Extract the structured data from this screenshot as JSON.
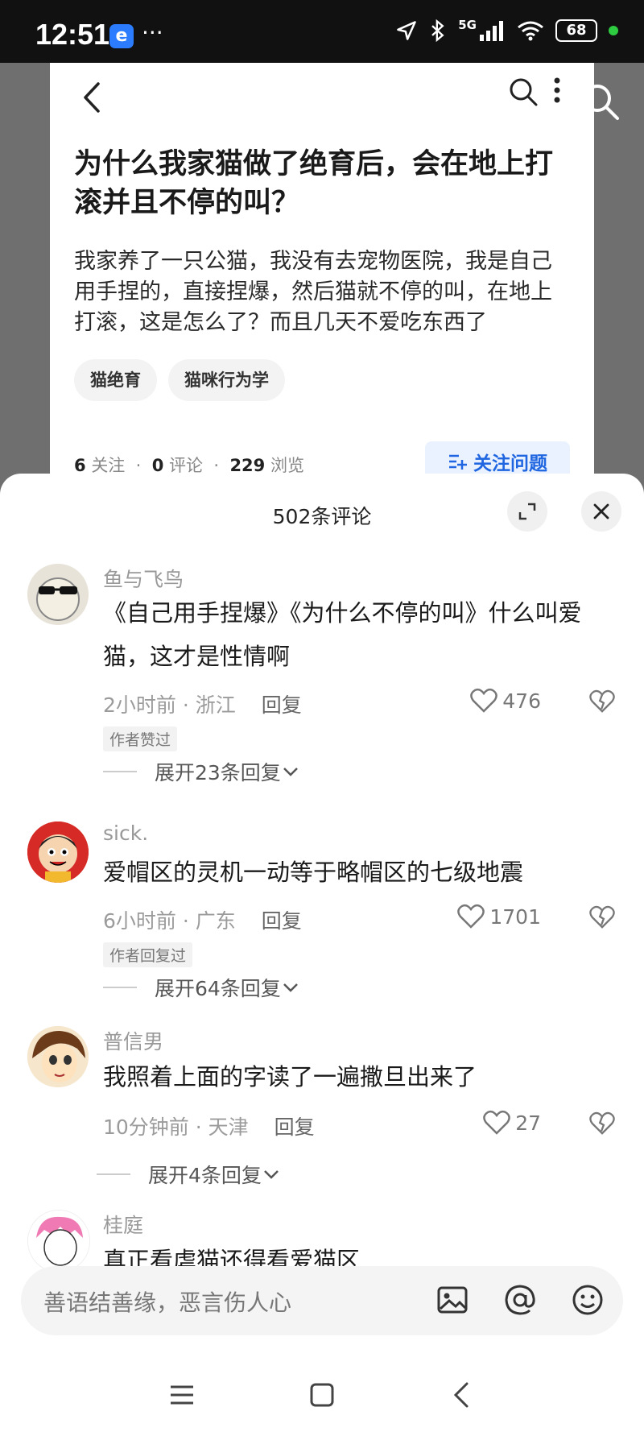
{
  "status": {
    "time": "12:51",
    "app_badge": "e",
    "dots": "···",
    "network": "5G",
    "battery": "68"
  },
  "question": {
    "title": "为什么我家猫做了绝育后，会在地上打滚并且不停的叫？",
    "body": "我家养了一只公猫，我没有去宠物医院，我是自己用手捏的，直接捏爆，然后猫就不停的叫，在地上打滚，这是怎么了？而且几天不爱吃东西了",
    "tags": [
      "猫绝育",
      "猫咪行为学"
    ],
    "stats": {
      "follows": "6",
      "follows_label": "关注",
      "comments": "0",
      "comments_label": "评论",
      "views": "229",
      "views_label": "浏览",
      "sep": "·"
    },
    "follow_button": "关注问题"
  },
  "sheet": {
    "title": "502条评论",
    "comments": [
      {
        "name": "鱼与飞鸟",
        "text": "《自己用手捏爆》《为什么不停的叫》什么叫爱猫，这才是性情啊",
        "time": "2小时前 · 浙江",
        "reply": "回复",
        "likes": "476",
        "tag": "作者赞过",
        "expand": "展开23条回复"
      },
      {
        "name": "sick.",
        "text": "爱帽区的灵机一动等于略帽区的七级地震",
        "time": "6小时前 · 广东",
        "reply": "回复",
        "likes": "1701",
        "tag": "作者回复过",
        "expand": "展开64条回复"
      },
      {
        "name": "普信男",
        "text": "我照着上面的字读了一遍撒旦出来了",
        "time": "10分钟前 · 天津",
        "reply": "回复",
        "likes": "27",
        "expand": "展开4条回复"
      },
      {
        "name": "桂庭",
        "text": "真正看虐猫还得看爱猫区"
      }
    ]
  },
  "input": {
    "placeholder": "善语结善缘，恶言伤人心"
  },
  "icons": {
    "status": [
      "location-icon",
      "bluetooth-icon",
      "signal-icon",
      "wifi-icon"
    ],
    "card": [
      "back-icon",
      "search-icon",
      "more-icon"
    ],
    "sheet": [
      "collapse-icon",
      "close-icon",
      "heart-icon",
      "dislike-icon",
      "chevron-down-icon"
    ],
    "input": [
      "image-icon",
      "at-icon",
      "emoji-icon"
    ],
    "nav": [
      "menu-icon",
      "home-icon",
      "back-icon"
    ]
  },
  "colors": {
    "accent": "#1f66e0",
    "follow_bg": "#eaf2ff",
    "overlay": "#6f6f6f"
  }
}
